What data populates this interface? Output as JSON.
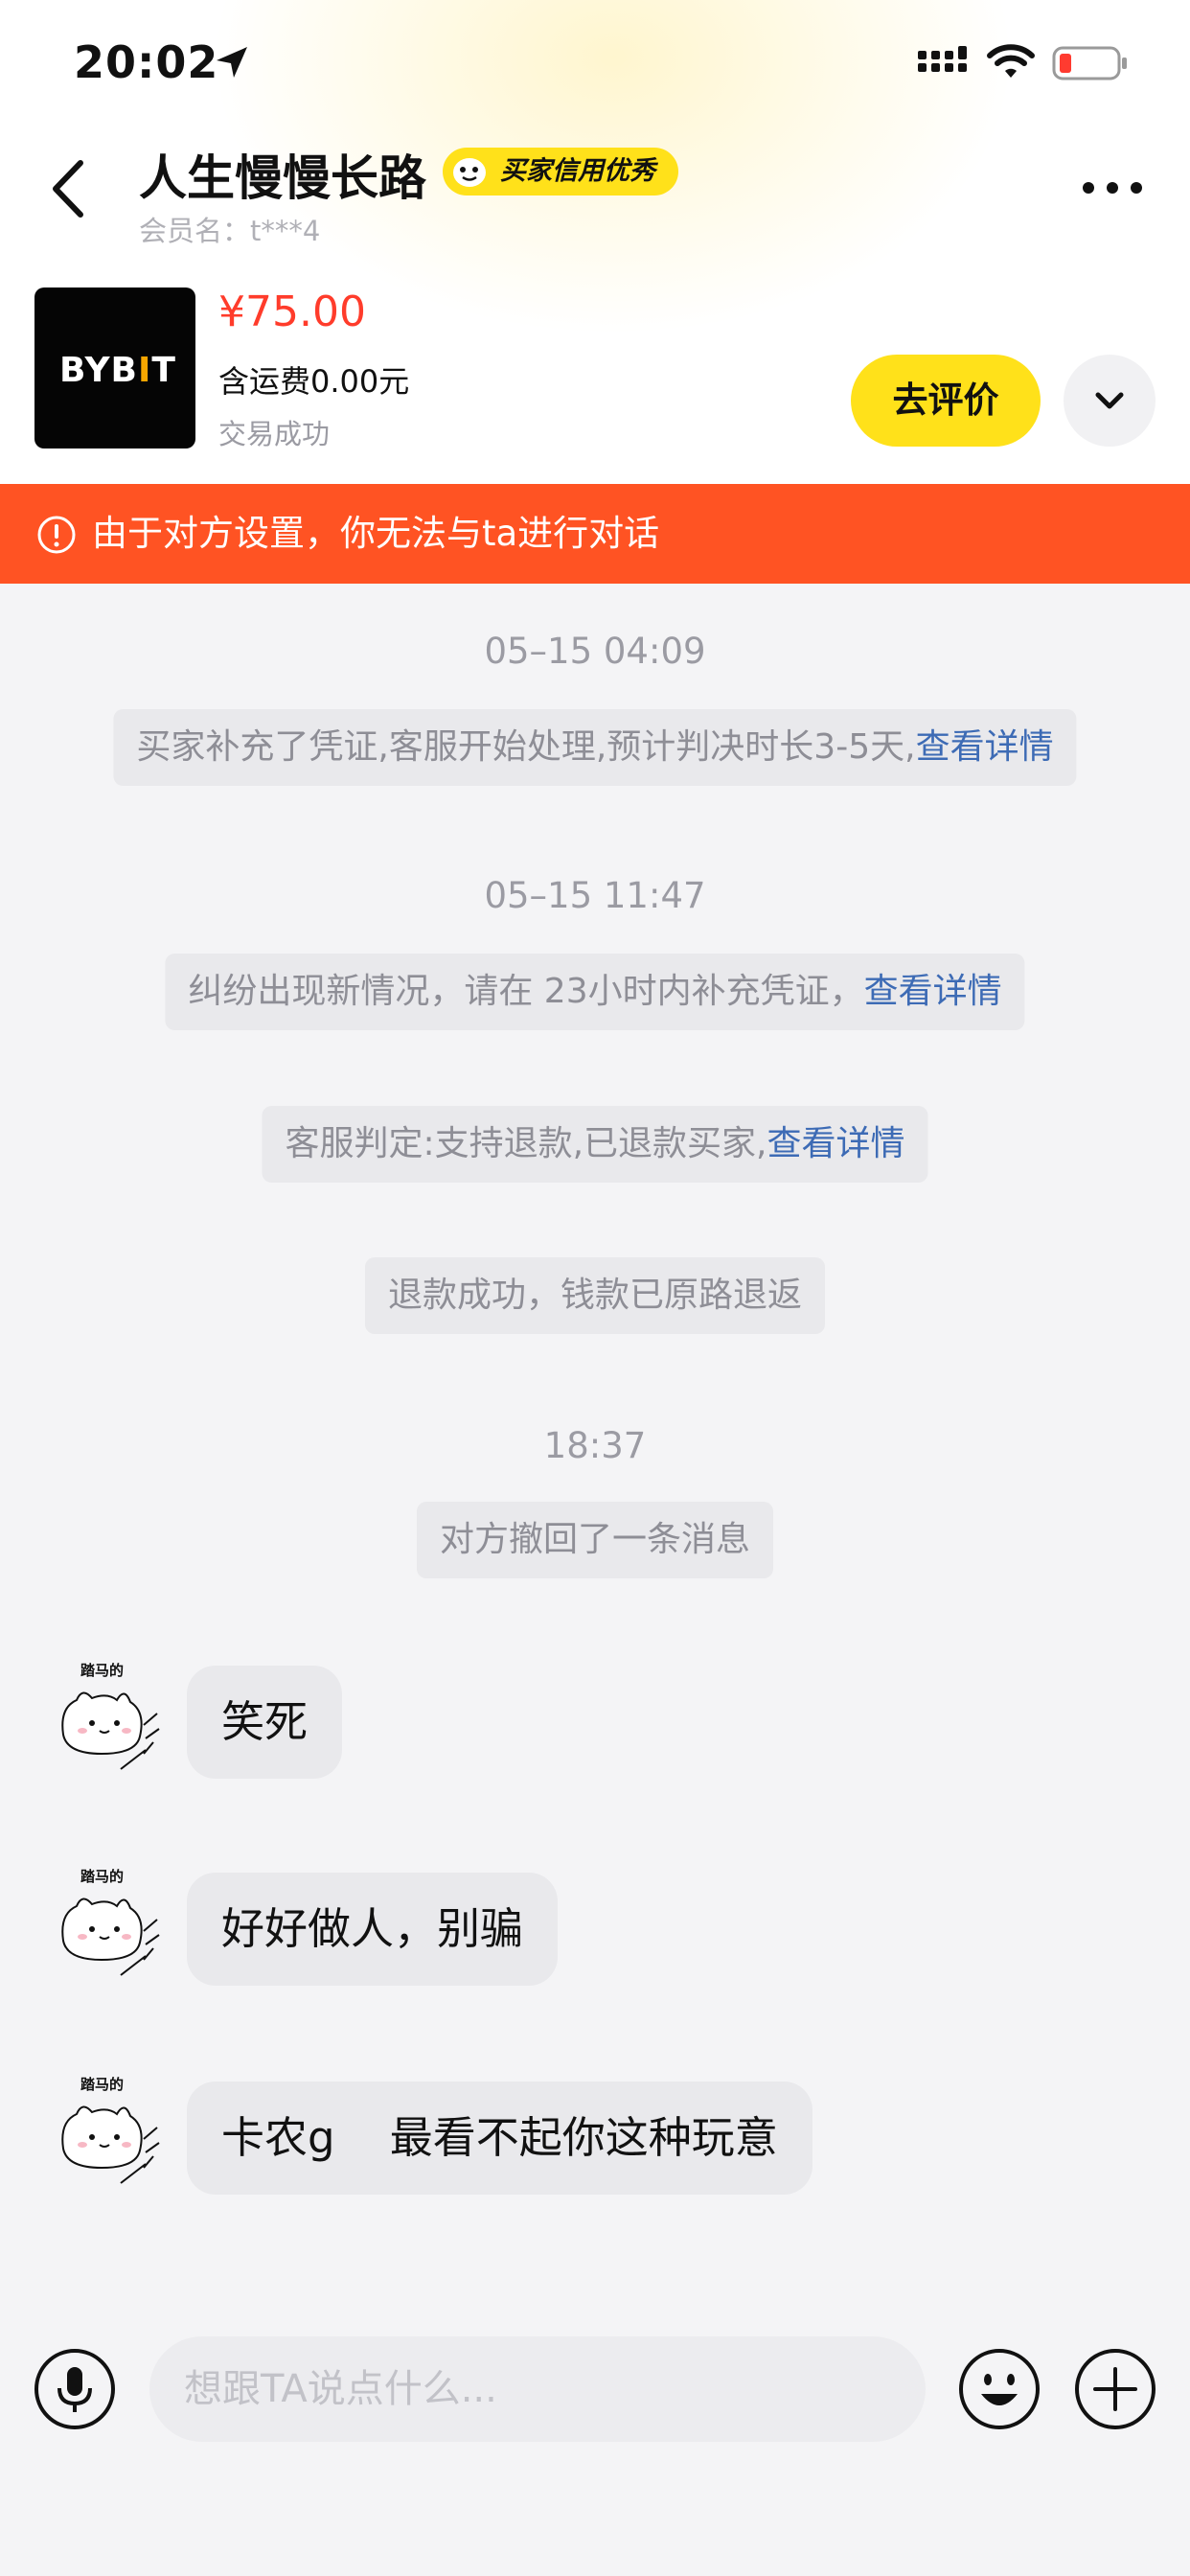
{
  "status_bar": {
    "time": "20:02"
  },
  "header": {
    "title": "人生慢慢长路",
    "badge": "买家信用优秀",
    "member_label": "会员名：t***4"
  },
  "product": {
    "thumb_logo": "BYB",
    "thumb_logo_mark": "I",
    "thumb_logo_end": "T",
    "price": "¥75.00",
    "shipping": "含运费0.00元",
    "status": "交易成功",
    "review_button": "去评价"
  },
  "banner": {
    "text": "由于对方设置，你无法与ta进行对话"
  },
  "messages": {
    "ts1": "05–15 04:09",
    "sys1_text": "买家补充了凭证,客服开始处理,预计判决时长3-5天,",
    "sys1_link": "查看详情",
    "ts2": "05–15 11:47",
    "sys2_text": "纠纷出现新情况，请在 23小时内补充凭证，",
    "sys2_link": "查看详情",
    "sys3_text": "客服判定:支持退款,已退款买家,",
    "sys3_link": "查看详情",
    "sys4_text": "退款成功，钱款已原路退返",
    "ts3": "18:37",
    "sys5_text": "对方撤回了一条消息",
    "chat": [
      {
        "avatar_caption": "踏马的",
        "text": "笑死"
      },
      {
        "avatar_caption": "踏马的",
        "text": "好好做人，别骗"
      },
      {
        "avatar_caption": "踏马的",
        "text": "卡农g    最看不起你这种玩意"
      }
    ]
  },
  "input_bar": {
    "placeholder": "想跟TA说点什么..."
  },
  "colors": {
    "accent_yellow": "#ffe11a",
    "price_red": "#ff3c2b",
    "banner_orange": "#ff5323",
    "link_blue": "#3d6bb5"
  }
}
